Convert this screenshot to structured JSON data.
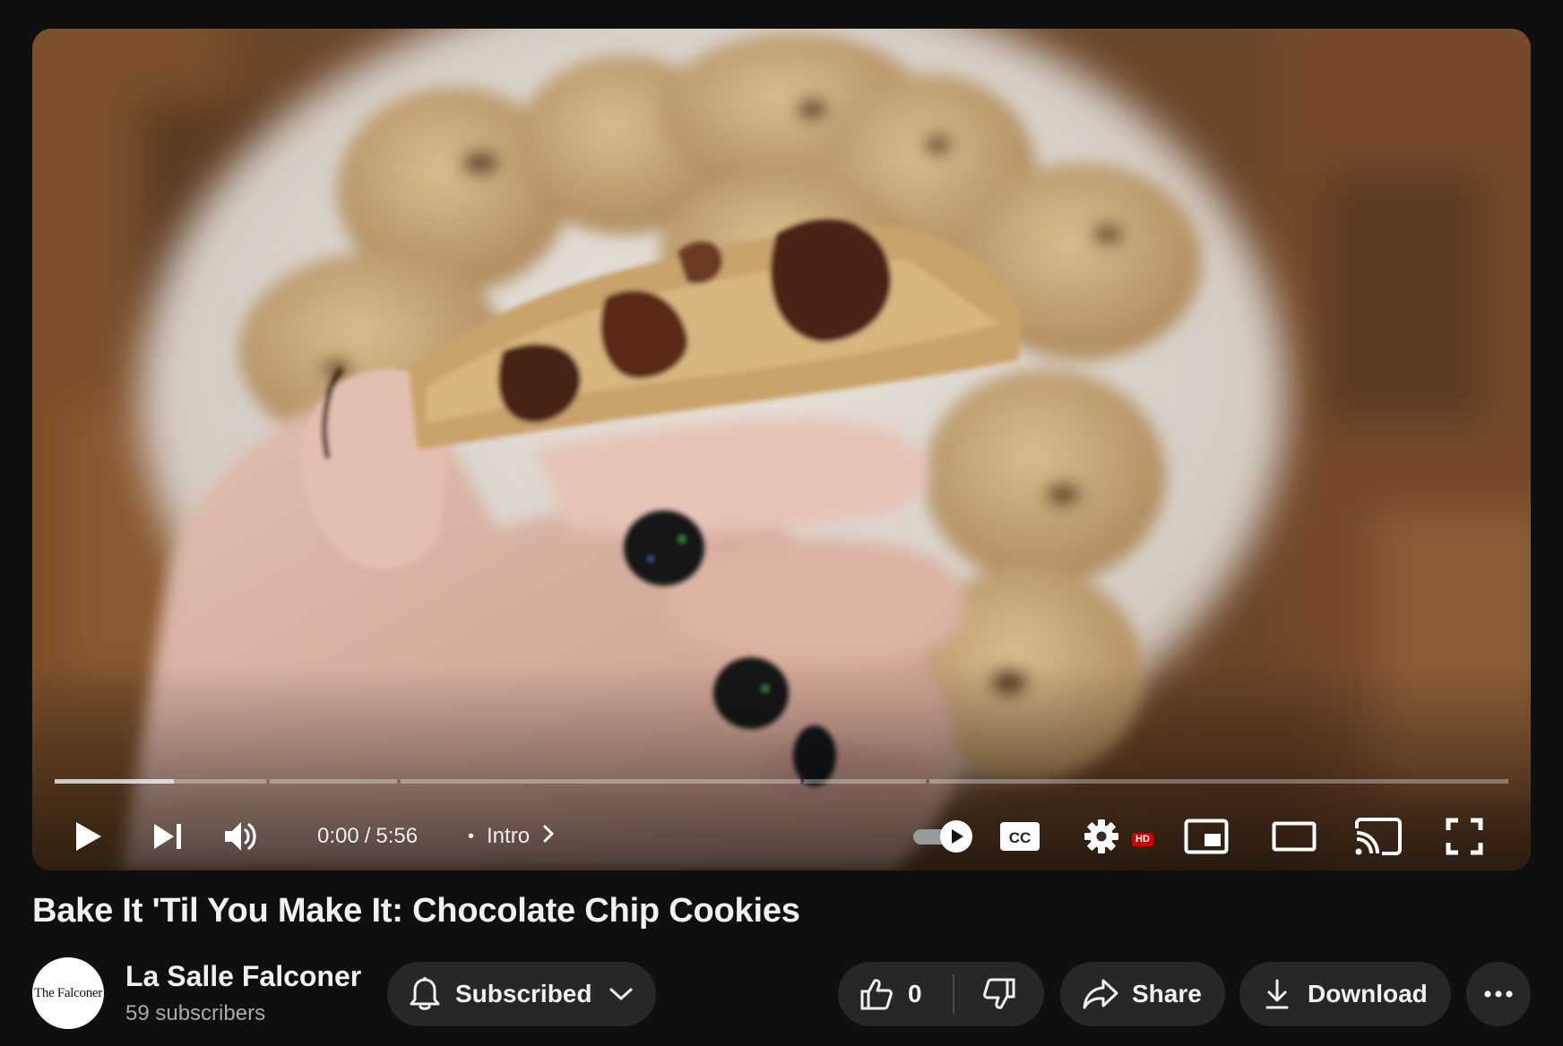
{
  "player": {
    "current_time": "0:00",
    "time_separator": "/",
    "duration": "5:56",
    "chapter_dot": "•",
    "chapter_title": "Intro",
    "progress_fraction": 0.0,
    "buffered_fraction": 0.082,
    "autoplay_on": true,
    "quality_badge": "HD",
    "icons": {
      "play": "play-icon",
      "next": "skip-next-icon",
      "volume": "volume-icon",
      "chapter_chevron": "chevron-right-icon",
      "autoplay": "autoplay-toggle-icon",
      "captions": "captions-icon",
      "settings": "gear-icon",
      "miniplayer": "miniplayer-icon",
      "theater": "theater-mode-icon",
      "cast": "cast-icon",
      "fullscreen": "fullscreen-icon"
    }
  },
  "video": {
    "title": "Bake It 'Til You Make It: Chocolate Chip Cookies"
  },
  "channel": {
    "name": "La Salle Falconer",
    "subscribers": "59 subscribers",
    "avatar_text": "The Falconer"
  },
  "actions": {
    "subscribe_label": "Subscribed",
    "like_count": "0",
    "share_label": "Share",
    "download_label": "Download",
    "icons": {
      "bell": "bell-icon",
      "subscribe_chevron": "chevron-down-icon",
      "like": "thumbs-up-icon",
      "dislike": "thumbs-down-icon",
      "share": "share-arrow-icon",
      "download": "download-icon",
      "more": "more-horizontal-icon"
    }
  },
  "colors": {
    "background": "#0f0f0f",
    "progress_played": "#ff0000",
    "pill_background": "#272727",
    "hd_badge": "#cc0000",
    "secondary_text": "#aaaaaa"
  }
}
